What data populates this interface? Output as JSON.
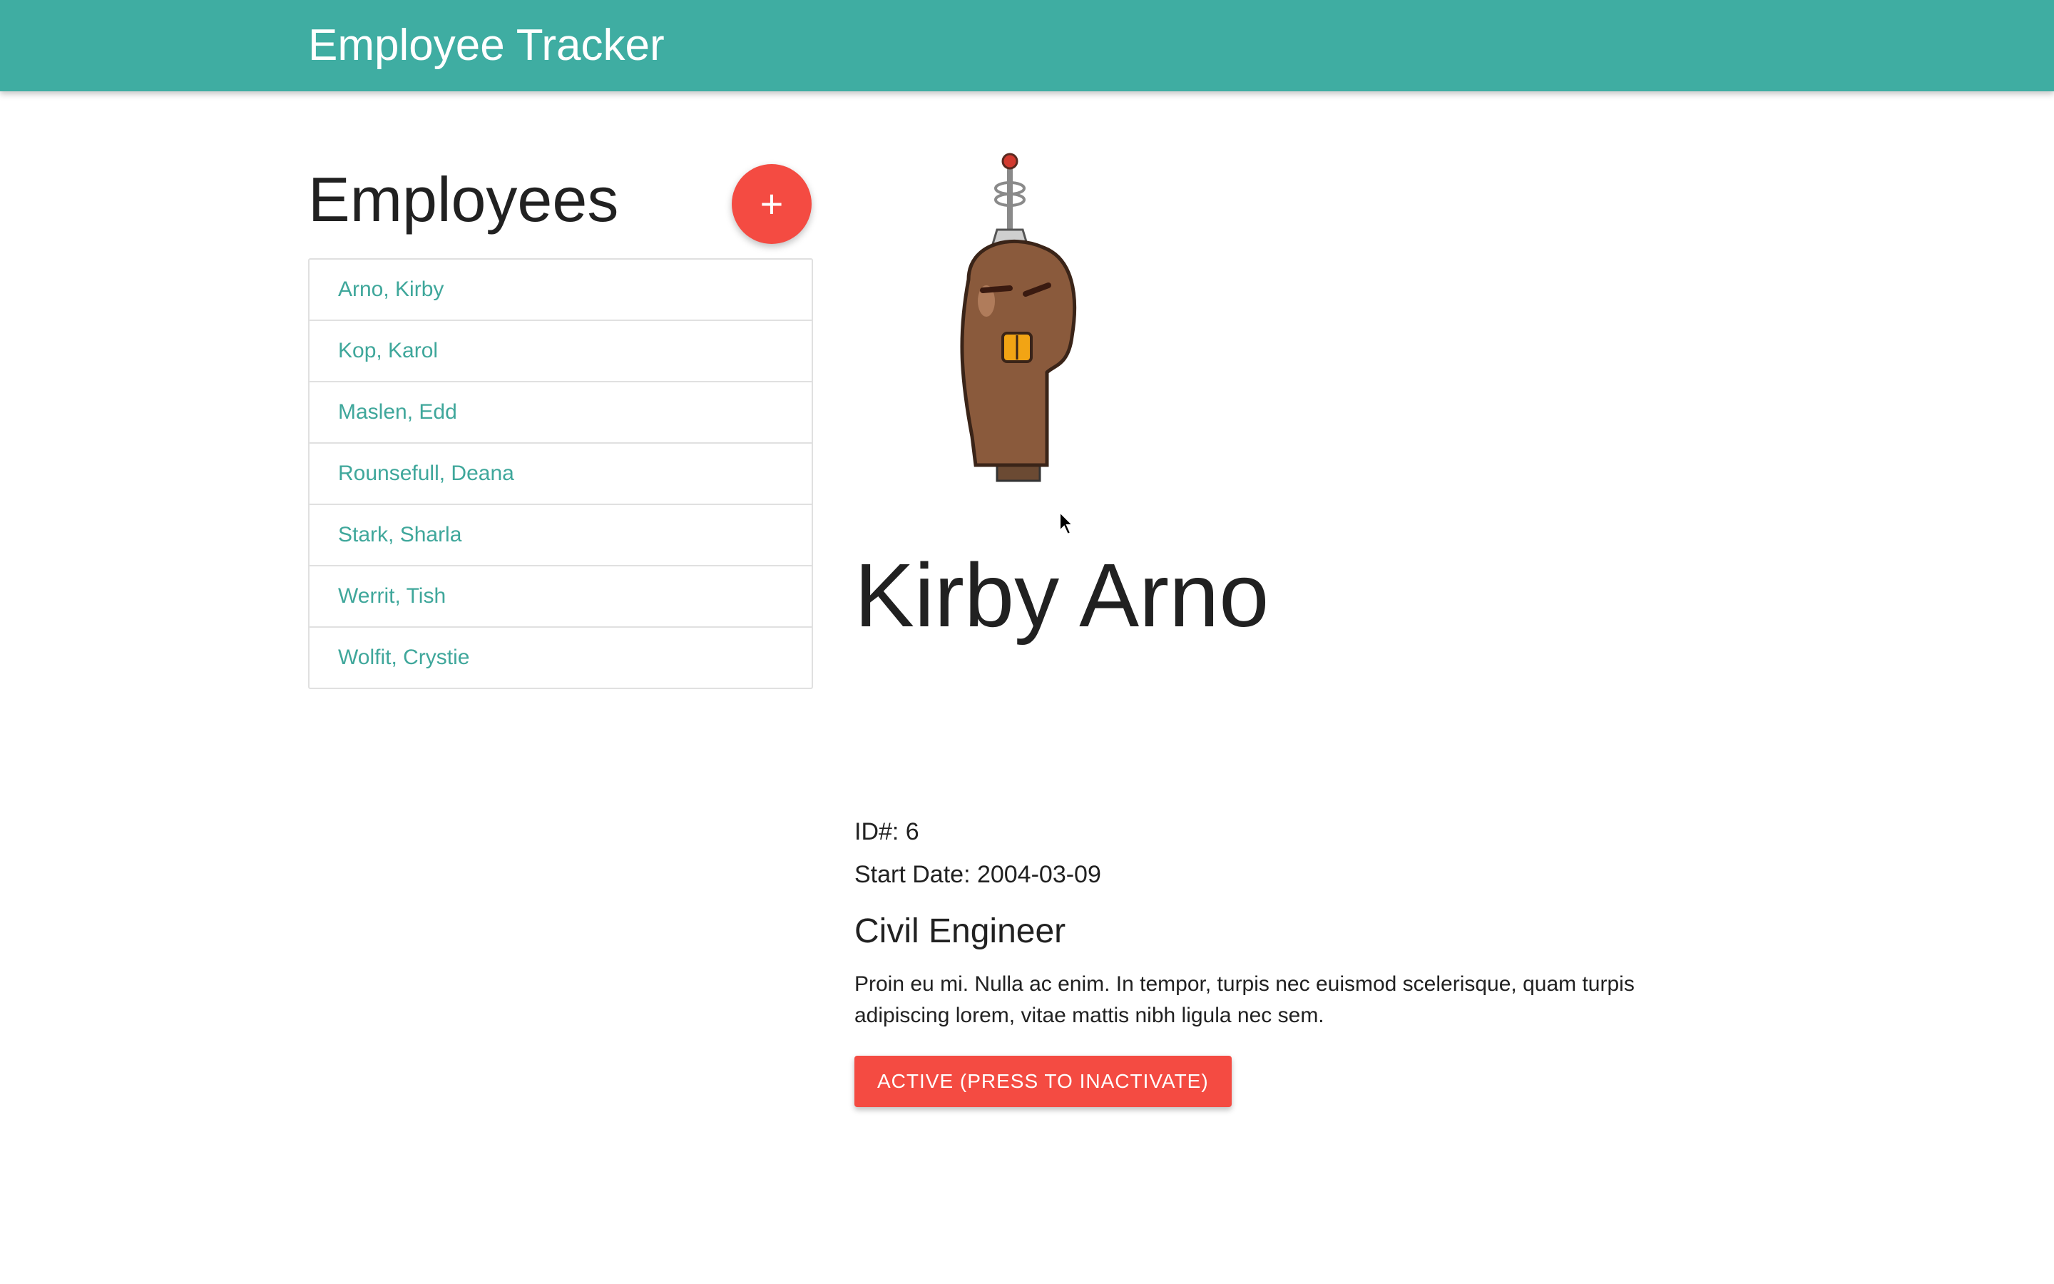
{
  "navbar": {
    "brand": "Employee Tracker"
  },
  "sidebar": {
    "title": "Employees",
    "add_button_label": "+",
    "employees": [
      "Arno, Kirby",
      "Kop, Karol",
      "Maslen, Edd",
      "Rounsefull, Deana",
      "Stark, Sharla",
      "Werrit, Tish",
      "Wolfit, Crystie"
    ]
  },
  "detail": {
    "avatar_icon": "robot-head-icon",
    "name": "Kirby Arno",
    "id_line": "ID#: 6",
    "start_date_line": "Start Date: 2004-03-09",
    "job_title": "Civil Engineer",
    "bio": "Proin eu mi. Nulla ac enim. In tempor, turpis nec euismod scelerisque, quam turpis adipiscing lorem, vitae mattis nibh ligula nec sem.",
    "status_button_label": "ACTIVE (PRESS TO INACTIVATE)"
  },
  "colors": {
    "navbar": "#3fada2",
    "link": "#3fa79b",
    "accent_red": "#f44b42"
  }
}
